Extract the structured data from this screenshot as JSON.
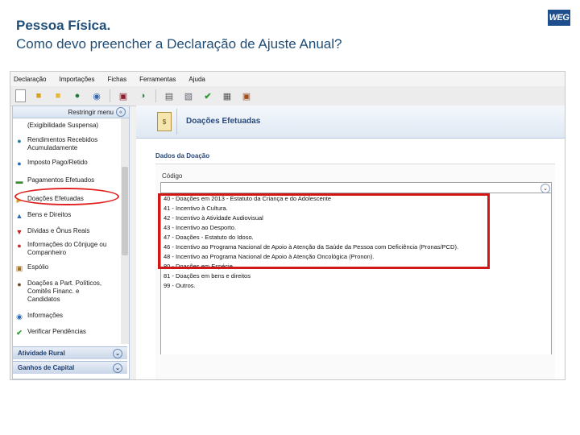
{
  "slide": {
    "title": "Pessoa Física.",
    "subtitle": "Como devo preencher a Declaração de Ajuste Anual?",
    "logo": "WEG"
  },
  "menubar": [
    "Declaração",
    "Importações",
    "Fichas",
    "Ferramentas",
    "Ajuda"
  ],
  "left_panel": {
    "header": "Restringir menu",
    "items": [
      {
        "label": "(Exigibilidade Suspensa)",
        "icon": "document-icon"
      },
      {
        "label": "Rendimentos Recebidos Acumuladamente",
        "icon": "money-icon"
      },
      {
        "label": "Imposto Pago/Retido",
        "icon": "tax-icon"
      },
      {
        "label": "Pagamentos Efetuados",
        "icon": "card-icon"
      },
      {
        "label": "Doações Efetuadas",
        "icon": "arrow-icon"
      },
      {
        "label": "Bens e Direitos",
        "icon": "house-icon"
      },
      {
        "label": "Dívidas e Ônus Reais",
        "icon": "debt-icon"
      },
      {
        "label": "Informações do Cônjuge ou Companheiro",
        "icon": "people-icon"
      },
      {
        "label": "Espólio",
        "icon": "briefcase-icon"
      },
      {
        "label": "Doações a Part. Políticos, Comitês Financ. e Candidatos",
        "icon": "person-icon"
      },
      {
        "label": "Informações",
        "icon": "info-icon"
      },
      {
        "label": "Verificar Pendências",
        "icon": "check-icon"
      }
    ],
    "groups": [
      "Atividade Rural",
      "Ganhos de Capital"
    ]
  },
  "main": {
    "title": "Doações Efetuadas",
    "section": "Dados da Doação",
    "field_label": "Código",
    "options": [
      "40 - Doações em 2013 - Estatuto da Criança e do Adolescente",
      "41 - Incentivo à Cultura.",
      "42 - Incentivo à Atividade Audiovisual",
      "43 - Incentivo ao Desporto.",
      "47 - Doações - Estatuto do Idoso.",
      "46 - Incentivo ao Programa Nacional de Apoio à Atenção da Saúde da Pessoa com Deficiência (Pronas/PCD).",
      "48 - Incentivo ao Programa Nacional de Apoio à Atenção Oncológica (Pronon).",
      "80 - Doações em Espécie.",
      "81 - Doações em bens e direitos",
      "99 - Outros."
    ]
  },
  "colors": {
    "title": "#1f4e79",
    "highlight": "#d01818",
    "panel_header": "#2a4a7a"
  }
}
